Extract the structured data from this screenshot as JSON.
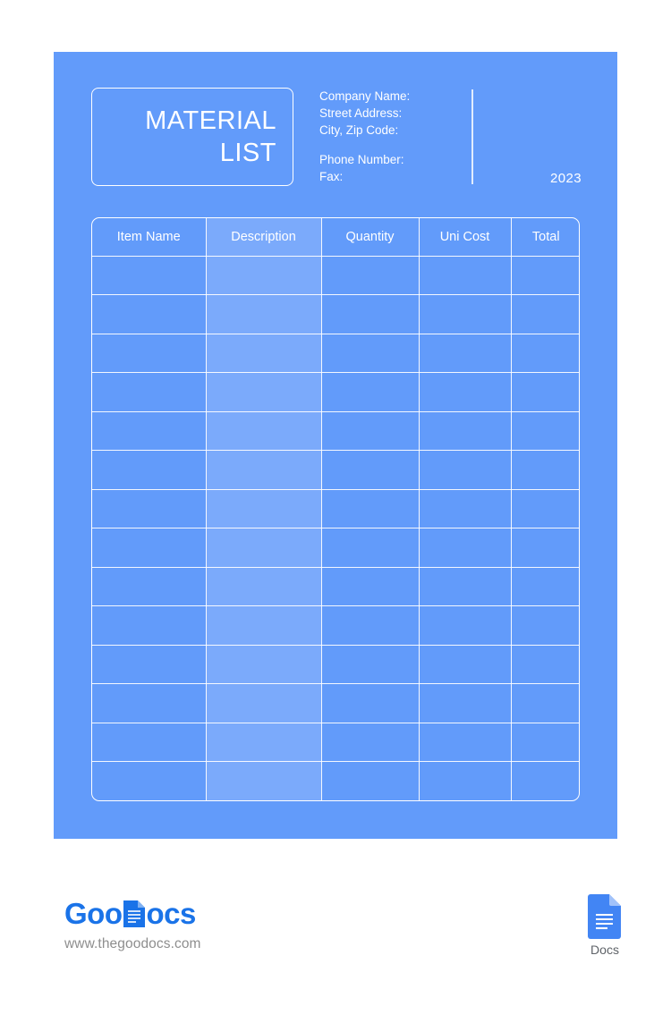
{
  "document": {
    "title": "MATERIAL\nLIST",
    "year": "2023",
    "company_fields": [
      "Company Name:",
      "Street Address:",
      "City, Zip Code:"
    ],
    "contact_fields": [
      "Phone Number:",
      "Fax:"
    ]
  },
  "table": {
    "columns": [
      "Item Name",
      "Description",
      "Quantity",
      "Uni Cost",
      "Total"
    ],
    "rows": [
      [
        "",
        "",
        "",
        "",
        ""
      ],
      [
        "",
        "",
        "",
        "",
        ""
      ],
      [
        "",
        "",
        "",
        "",
        ""
      ],
      [
        "",
        "",
        "",
        "",
        ""
      ],
      [
        "",
        "",
        "",
        "",
        ""
      ],
      [
        "",
        "",
        "",
        "",
        ""
      ],
      [
        "",
        "",
        "",
        "",
        ""
      ],
      [
        "",
        "",
        "",
        "",
        ""
      ],
      [
        "",
        "",
        "",
        "",
        ""
      ],
      [
        "",
        "",
        "",
        "",
        ""
      ],
      [
        "",
        "",
        "",
        "",
        ""
      ],
      [
        "",
        "",
        "",
        "",
        ""
      ],
      [
        "",
        "",
        "",
        "",
        ""
      ],
      [
        "",
        "",
        "",
        "",
        ""
      ]
    ]
  },
  "footer": {
    "brand_part_1": "Goo",
    "brand_part_2": "ocs",
    "url": "www.thegoodocs.com",
    "docs_label": "Docs"
  },
  "colors": {
    "page_background": "#629BFA",
    "description_column": "#7BAAFB",
    "rule": "#FFFFFF",
    "brand_blue": "#1A73E8",
    "docs_icon_blue": "#4285F4",
    "url_gray": "#8E8E8E"
  }
}
